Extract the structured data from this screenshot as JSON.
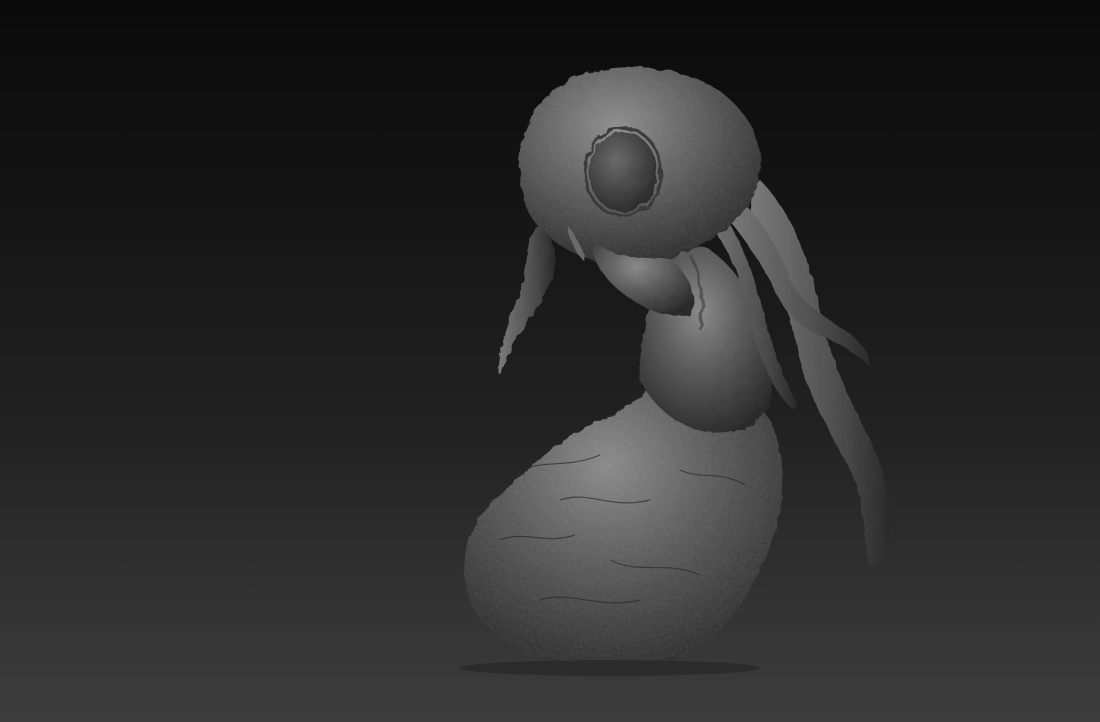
{
  "viewport": {
    "background_top": "#0a0a0a",
    "background_bottom": "#3c3c3c"
  },
  "model": {
    "subject": "sculpted-creature-on-rock",
    "material_color": "#5a5a5a",
    "highlight_color": "#8a8a8a",
    "shadow_color": "#262626"
  }
}
